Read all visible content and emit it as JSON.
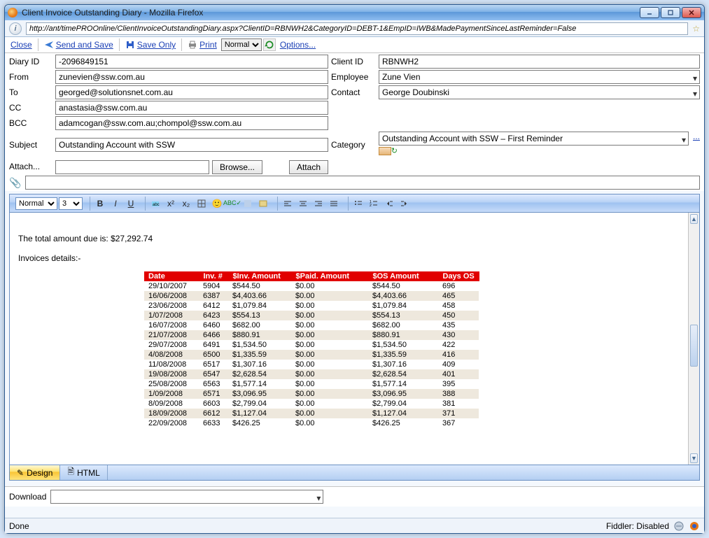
{
  "window": {
    "title": "Client Invoice Outstanding Diary - Mozilla Firefox"
  },
  "url": "http://ant/timePROOnline/ClientInvoiceOutstandingDiary.aspx?ClientID=RBNWH2&CategoryID=DEBT-1&EmpID=IWB&MadePaymentSinceLastReminder=False",
  "toolbar": {
    "close": "Close",
    "send_save": "Send and Save",
    "save_only": "Save Only",
    "print": "Print",
    "view_mode": "Normal",
    "options": "Options..."
  },
  "form": {
    "diary_label": "Diary ID",
    "diary_value": "-2096849151",
    "from_label": "From",
    "from_value": "zunevien@ssw.com.au",
    "to_label": "To",
    "to_value": "georged@solutionsnet.com.au",
    "cc_label": "CC",
    "cc_value": "anastasia@ssw.com.au",
    "bcc_label": "BCC",
    "bcc_value": "adamcogan@ssw.com.au;chompol@ssw.com.au",
    "subject_label": "Subject",
    "subject_value": "Outstanding Account with SSW",
    "attach_label": "Attach...",
    "browse_btn": "Browse...",
    "attach_btn": "Attach",
    "client_label": "Client ID",
    "client_value": "RBNWH2",
    "employee_label": "Employee",
    "employee_value": "Zune Vien",
    "contact_label": "Contact",
    "contact_value": "George Doubinski",
    "category_label": "Category",
    "category_value": "Outstanding Account with SSW – First Reminder"
  },
  "editor": {
    "style_sel": "Normal",
    "size_sel": "3",
    "body_total": "The total amount due is: $27,292.74",
    "body_details": "Invoices details:-",
    "columns": [
      "Date",
      "Inv. #",
      "$Inv. Amount",
      "$Paid. Amount",
      "$OS Amount",
      "Days OS"
    ],
    "rows": [
      [
        "29/10/2007",
        "5904",
        "$544.50",
        "$0.00",
        "$544.50",
        "696"
      ],
      [
        "16/06/2008",
        "6387",
        "$4,403.66",
        "$0.00",
        "$4,403.66",
        "465"
      ],
      [
        "23/06/2008",
        "6412",
        "$1,079.84",
        "$0.00",
        "$1,079.84",
        "458"
      ],
      [
        "1/07/2008",
        "6423",
        "$554.13",
        "$0.00",
        "$554.13",
        "450"
      ],
      [
        "16/07/2008",
        "6460",
        "$682.00",
        "$0.00",
        "$682.00",
        "435"
      ],
      [
        "21/07/2008",
        "6466",
        "$880.91",
        "$0.00",
        "$880.91",
        "430"
      ],
      [
        "29/07/2008",
        "6491",
        "$1,534.50",
        "$0.00",
        "$1,534.50",
        "422"
      ],
      [
        "4/08/2008",
        "6500",
        "$1,335.59",
        "$0.00",
        "$1,335.59",
        "416"
      ],
      [
        "11/08/2008",
        "6517",
        "$1,307.16",
        "$0.00",
        "$1,307.16",
        "409"
      ],
      [
        "19/08/2008",
        "6547",
        "$2,628.54",
        "$0.00",
        "$2,628.54",
        "401"
      ],
      [
        "25/08/2008",
        "6563",
        "$1,577.14",
        "$0.00",
        "$1,577.14",
        "395"
      ],
      [
        "1/09/2008",
        "6571",
        "$3,096.95",
        "$0.00",
        "$3,096.95",
        "388"
      ],
      [
        "8/09/2008",
        "6603",
        "$2,799.04",
        "$0.00",
        "$2,799.04",
        "381"
      ],
      [
        "18/09/2008",
        "6612",
        "$1,127.04",
        "$0.00",
        "$1,127.04",
        "371"
      ],
      [
        "22/09/2008",
        "6633",
        "$426.25",
        "$0.00",
        "$426.25",
        "367"
      ]
    ]
  },
  "tabs": {
    "design": "Design",
    "html": "HTML"
  },
  "download": {
    "label": "Download"
  },
  "status": {
    "left": "Done",
    "right": "Fiddler: Disabled"
  }
}
